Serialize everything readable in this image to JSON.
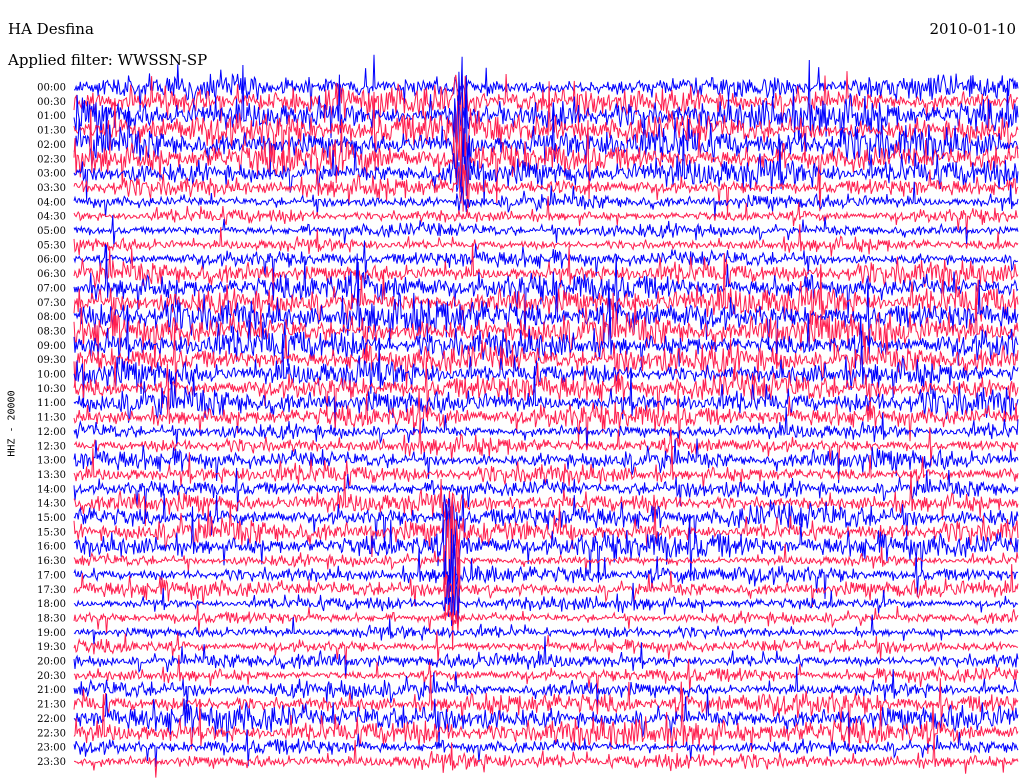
{
  "header": {
    "station": "HA Desfina",
    "filter": "Applied filter: WWSSN-SP",
    "date": "2010-01-10"
  },
  "chart_data": {
    "type": "line",
    "title": "HA Desfina",
    "subtitle": "Applied filter: WWSSN-SP",
    "ylabel": "HHZ - 20000",
    "xlabel": "",
    "grid": false,
    "tick_labels": [
      "00:00",
      "00:30",
      "01:00",
      "01:30",
      "02:00",
      "02:30",
      "03:00",
      "03:30",
      "04:00",
      "04:30",
      "05:00",
      "05:30",
      "06:00",
      "06:30",
      "07:00",
      "07:30",
      "08:00",
      "08:30",
      "09:00",
      "09:30",
      "10:00",
      "10:30",
      "11:00",
      "11:30",
      "12:00",
      "12:30",
      "13:00",
      "13:30",
      "14:00",
      "14:30",
      "15:00",
      "15:30",
      "16:00",
      "16:30",
      "17:00",
      "17:30",
      "18:00",
      "18:30",
      "19:00",
      "19:30",
      "20:00",
      "20:30",
      "21:00",
      "21:30",
      "22:00",
      "22:30",
      "23:00",
      "23:30"
    ],
    "colors": [
      "#0000ff",
      "#ff1f4f"
    ],
    "amplitude_per_row": [
      1.6,
      2.0,
      2.4,
      2.2,
      2.4,
      2.2,
      2.0,
      1.3,
      1.0,
      0.9,
      0.9,
      0.9,
      1.1,
      1.6,
      1.9,
      2.2,
      2.4,
      2.4,
      2.1,
      2.0,
      1.9,
      1.8,
      1.9,
      1.6,
      1.1,
      1.1,
      1.4,
      1.3,
      1.2,
      1.4,
      1.6,
      1.7,
      1.8,
      0.8,
      1.2,
      1.2,
      0.9,
      0.8,
      0.8,
      0.9,
      1.1,
      0.9,
      1.2,
      1.5,
      1.9,
      1.9,
      1.0,
      1.1
    ],
    "events": [
      {
        "time": "02:00",
        "x_fraction": 0.41,
        "note": "large transient"
      },
      {
        "time": "16:30",
        "x_fraction": 0.4,
        "note": "transient"
      }
    ]
  }
}
